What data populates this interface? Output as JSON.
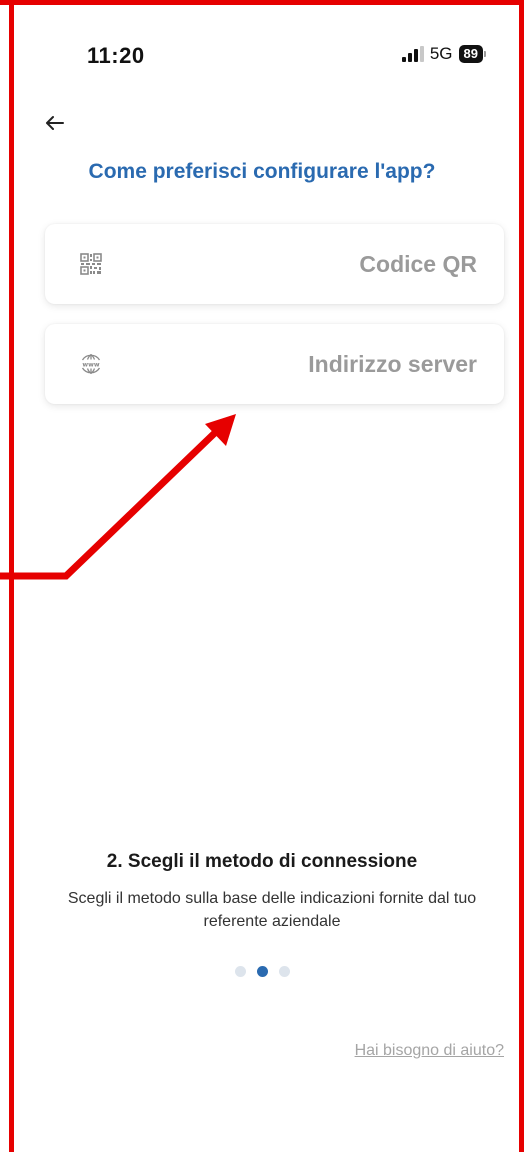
{
  "status_bar": {
    "time": "11:20",
    "network": "5G",
    "battery": "89"
  },
  "header": {
    "back_icon": "arrow-left-icon",
    "title": "Come preferisci configurare l'app?"
  },
  "options": [
    {
      "icon": "qr-code-icon",
      "label": "Codice QR"
    },
    {
      "icon": "www-globe-icon",
      "label": "Indirizzo server"
    }
  ],
  "step": {
    "title": "2. Scegli il metodo di connessione",
    "description": "Scegli il metodo sulla base delle indicazioni fornite dal tuo referente aziendale",
    "current_page": 2,
    "total_pages": 3
  },
  "footer": {
    "help_link": "Hai bisogno di aiuto?"
  },
  "colors": {
    "accent": "#2a6ab0",
    "annotation": "#e60000",
    "option_text": "#9a9a9a"
  }
}
